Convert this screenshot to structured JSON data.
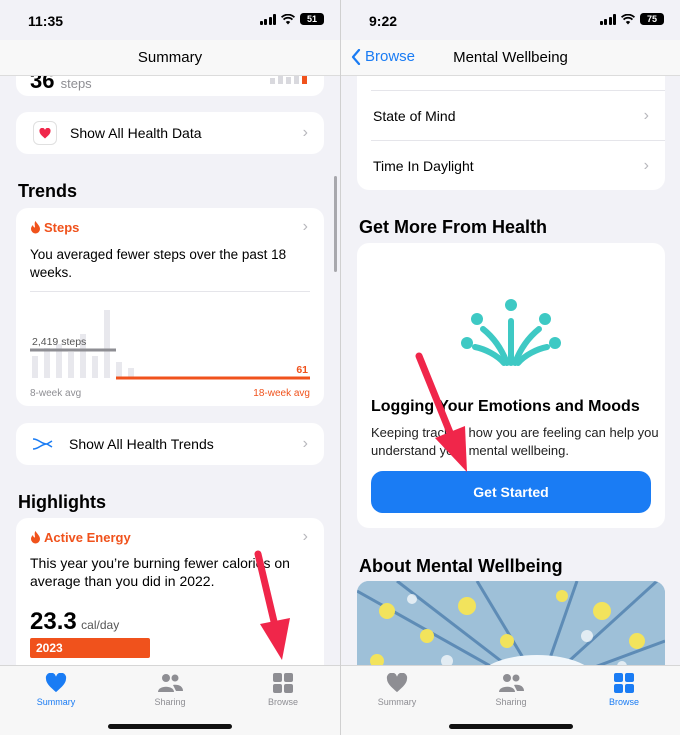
{
  "left": {
    "status": {
      "time": "11:35",
      "battery": "51"
    },
    "nav": {
      "title": "Summary"
    },
    "partial_card": {
      "value": "36",
      "unit": "steps"
    },
    "show_all_data": {
      "label": "Show All Health Data"
    },
    "trends": {
      "heading": "Trends",
      "metric": "Steps",
      "summary": "You averaged fewer steps over the past 18 weeks.",
      "avg_label": "2,419 steps",
      "recent_value": "61",
      "x_left": "8-week avg",
      "x_right": "18-week avg"
    },
    "show_all_trends": {
      "label": "Show All Health Trends"
    },
    "highlights": {
      "heading": "Highlights",
      "metric": "Active Energy",
      "summary": "This year you’re burning fewer calories on average than you did in 2022.",
      "value": "23.3",
      "unit": "cal/day",
      "year": "2023"
    },
    "tabs": [
      {
        "label": "Summary",
        "icon": "heart-icon"
      },
      {
        "label": "Sharing",
        "icon": "people-icon"
      },
      {
        "label": "Browse",
        "icon": "grid-icon"
      }
    ]
  },
  "right": {
    "status": {
      "time": "9:22",
      "battery": "75"
    },
    "nav": {
      "back": "Browse",
      "title": "Mental Wellbeing"
    },
    "list": [
      {
        "label": "State of Mind"
      },
      {
        "label": "Time In Daylight"
      }
    ],
    "get_more": {
      "heading": "Get More From Health",
      "card_title": "Logging Your Emotions and Moods",
      "card_body": "Keeping track of how you are feeling can help you understand your mental wellbeing.",
      "button": "Get Started"
    },
    "about": {
      "heading": "About Mental Wellbeing"
    },
    "tabs": [
      {
        "label": "Summary",
        "icon": "heart-icon"
      },
      {
        "label": "Sharing",
        "icon": "people-icon"
      },
      {
        "label": "Browse",
        "icon": "grid-icon"
      }
    ]
  },
  "colors": {
    "accent": "#1a7cf4",
    "orange": "#f0521c",
    "teal": "#3ec9c4",
    "annotation": "#f0264a"
  }
}
